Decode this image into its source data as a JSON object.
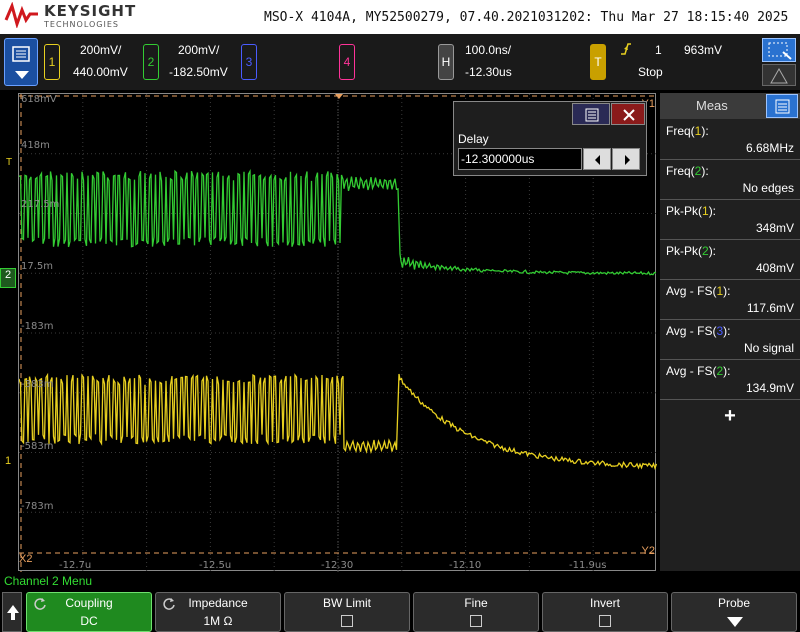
{
  "brand": {
    "name": "KEYSIGHT",
    "sub": "TECHNOLOGIES"
  },
  "banner_info": "MSO-X 4104A, MY52500279, 07.40.2021031202: Thu Mar 27 18:15:40 2025",
  "channels": [
    {
      "num": "1",
      "scale": "200mV/",
      "offset": "440.00mV",
      "color": "#e8d020"
    },
    {
      "num": "2",
      "scale": "200mV/",
      "offset": "-182.50mV",
      "color": "#33cc33"
    },
    {
      "num": "3",
      "color": "#4a5cff"
    },
    {
      "num": "4",
      "color": "#ff3399"
    }
  ],
  "horizontal": {
    "label": "H",
    "timebase": "100.0ns/",
    "delay": "-12.30us"
  },
  "trigger": {
    "label": "T",
    "source": "1",
    "level": "963mV",
    "state": "Stop"
  },
  "grid": {
    "y_labels": [
      "618mV",
      "418m",
      "217.5m",
      "17.5m",
      "-183m",
      "-383m",
      "-583m",
      "-783m"
    ],
    "x_labels": [
      "-12.7u",
      "-12.5u",
      "-12.30",
      "-12.10",
      "-11.9us"
    ],
    "markers": {
      "x2": "X2",
      "y2": "Y2",
      "y1": "Y1",
      "t": "T",
      "ch1": "1",
      "ch2": "2"
    }
  },
  "delay_popup": {
    "title": "Delay",
    "value": "-12.300000us"
  },
  "meas": {
    "title": "Meas",
    "items": [
      {
        "name": "Freq(",
        "ch": "1",
        "suffix": "):",
        "value": "6.68MHz",
        "chcolor": "#e8d020"
      },
      {
        "name": "Freq(",
        "ch": "2",
        "suffix": "):",
        "value": "No edges",
        "chcolor": "#33cc33"
      },
      {
        "name": "Pk-Pk(",
        "ch": "1",
        "suffix": "):",
        "value": "348mV",
        "chcolor": "#e8d020"
      },
      {
        "name": "Pk-Pk(",
        "ch": "2",
        "suffix": "):",
        "value": "408mV",
        "chcolor": "#33cc33"
      },
      {
        "name": "Avg - FS(",
        "ch": "1",
        "suffix": "):",
        "value": "117.6mV",
        "chcolor": "#e8d020"
      },
      {
        "name": "Avg - FS(",
        "ch": "3",
        "suffix": "):",
        "value": "No signal",
        "chcolor": "#4a5cff"
      },
      {
        "name": "Avg - FS(",
        "ch": "2",
        "suffix": "):",
        "value": "134.9mV",
        "chcolor": "#33cc33"
      }
    ],
    "add": "+"
  },
  "menu_title": "Channel 2 Menu",
  "softkeys": [
    {
      "top": "Coupling",
      "bottom": "DC",
      "active": true
    },
    {
      "top": "Impedance",
      "bottom": "1M Ω"
    },
    {
      "top": "BW Limit",
      "check": true
    },
    {
      "top": "Fine",
      "check": true
    },
    {
      "top": "Invert",
      "check": true
    },
    {
      "top": "Probe",
      "arrow": true
    }
  ],
  "colors": {
    "ch1": "#e8d020",
    "ch2": "#33cc33",
    "ch3": "#4a5cff",
    "ch4": "#ff3399",
    "cursor": "#e8a060"
  }
}
